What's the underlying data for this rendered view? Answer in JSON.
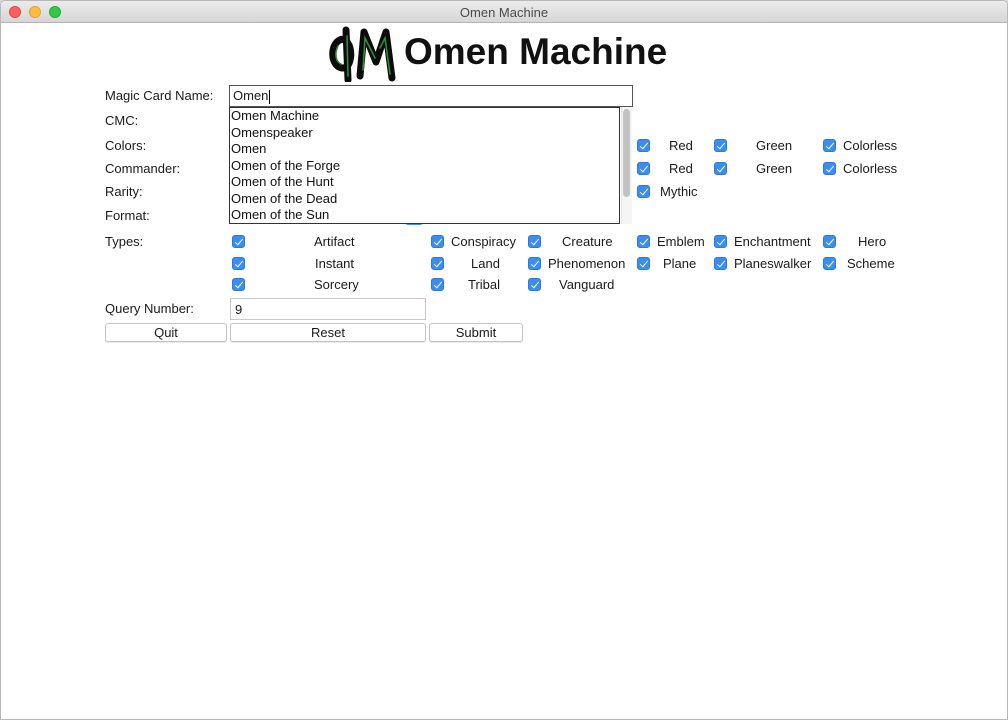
{
  "window": {
    "title": "Omen Machine"
  },
  "app": {
    "title": "Omen Machine"
  },
  "form": {
    "card_name_label": "Magic Card Name:",
    "card_name_value": "Omen",
    "cmc_label": "CMC:",
    "colors_label": "Colors:",
    "commander_label": "Commander:",
    "rarity_label": "Rarity:",
    "format_label": "Format:",
    "types_label": "Types:",
    "query_label": "Query Number:",
    "query_value": "9"
  },
  "autocomplete": [
    "Omen Machine",
    "Omenspeaker",
    "Omen",
    "Omen of the Forge",
    "Omen of the Hunt",
    "Omen of the Dead",
    "Omen of the Sun"
  ],
  "colors": {
    "red": "Red",
    "green": "Green",
    "colorless": "Colorless"
  },
  "commander": {
    "red": "Red",
    "green": "Green",
    "colorless": "Colorless"
  },
  "rarity": {
    "mythic": "Mythic"
  },
  "types": {
    "artifact": "Artifact",
    "conspiracy": "Conspiracy",
    "creature": "Creature",
    "emblem": "Emblem",
    "enchantment": "Enchantment",
    "hero": "Hero",
    "instant": "Instant",
    "land": "Land",
    "phenomenon": "Phenomenon",
    "plane": "Plane",
    "planeswalker": "Planeswalker",
    "scheme": "Scheme",
    "sorcery": "Sorcery",
    "tribal": "Tribal",
    "vanguard": "Vanguard"
  },
  "buttons": {
    "quit": "Quit",
    "reset": "Reset",
    "submit": "Submit"
  },
  "theme": {
    "checkbox": "#3b8df2",
    "logo_green": "#2f8a3a"
  }
}
